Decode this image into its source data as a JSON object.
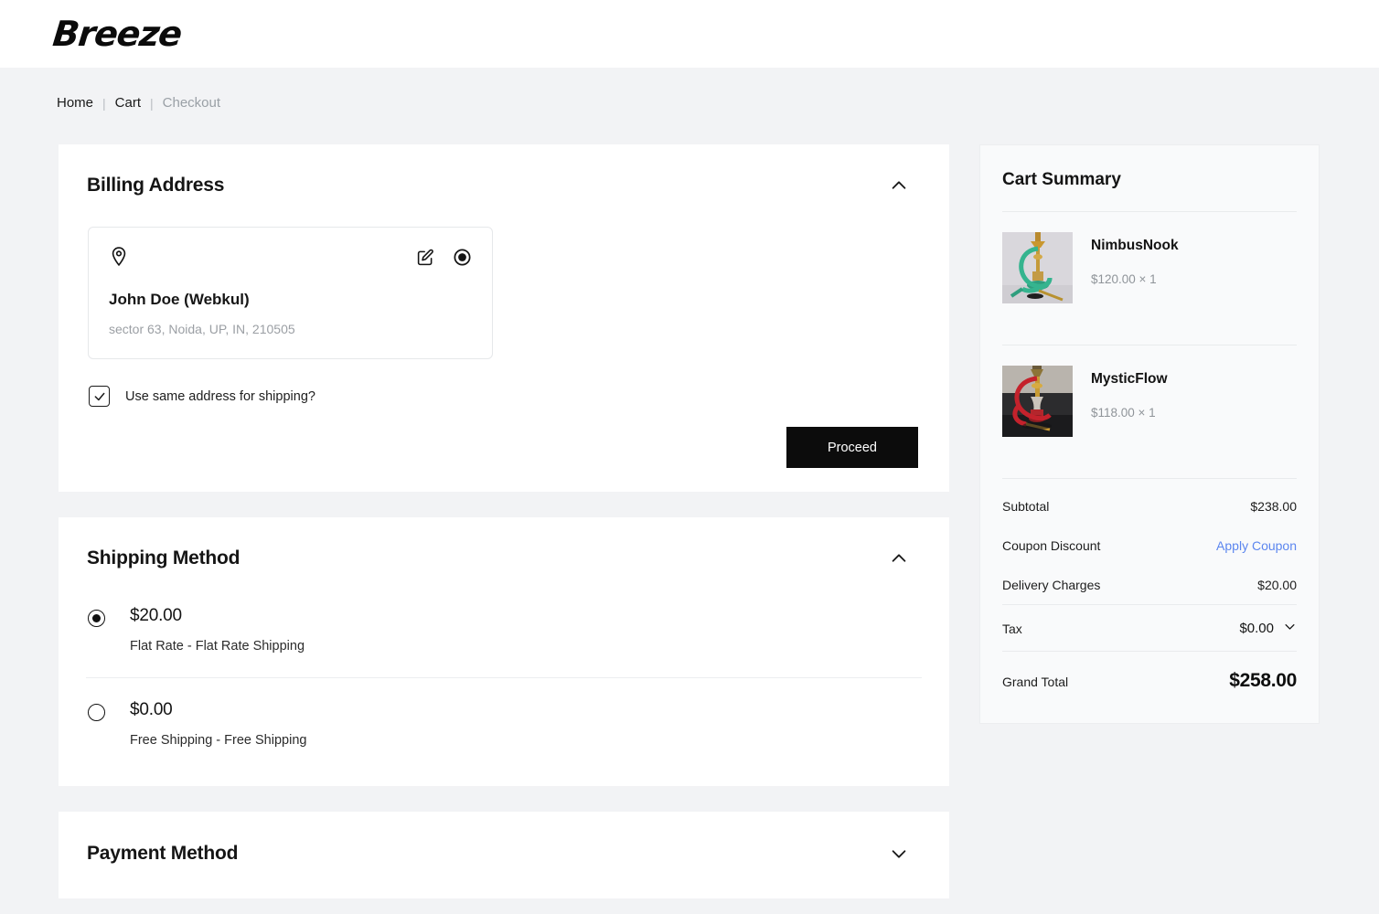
{
  "header": {
    "logo_text": "Breeze"
  },
  "breadcrumb": {
    "items": [
      {
        "label": "Home",
        "current": false
      },
      {
        "label": "Cart",
        "current": false
      },
      {
        "label": "Checkout",
        "current": true
      }
    ],
    "separator": "|"
  },
  "billing": {
    "title": "Billing Address",
    "collapse_icon": "chevron-up-icon",
    "address": {
      "pin_icon": "location-pin-icon",
      "edit_icon": "edit-pencil-icon",
      "select_icon": "radio-selected-icon",
      "name": "John Doe (Webkul)",
      "line": "sector 63, Noida, UP, IN, 210505"
    },
    "same_address_label": "Use same address for shipping?",
    "same_address_checked": true,
    "proceed_label": "Proceed"
  },
  "shipping": {
    "title": "Shipping Method",
    "collapse_icon": "chevron-up-icon",
    "options": [
      {
        "price": "$20.00",
        "description": "Flat Rate - Flat Rate Shipping",
        "selected": true
      },
      {
        "price": "$0.00",
        "description": "Free Shipping - Free Shipping",
        "selected": false
      }
    ]
  },
  "payment": {
    "title": "Payment Method",
    "collapse_icon": "chevron-down-icon"
  },
  "cart_summary": {
    "title": "Cart Summary",
    "items": [
      {
        "name": "NimbusNook",
        "price_qty": "$120.00 × 1",
        "image": "green-hose-hookah-photo"
      },
      {
        "name": "MysticFlow",
        "price_qty": "$118.00 × 1",
        "image": "red-hose-hookah-photo"
      }
    ],
    "totals": {
      "subtotal_label": "Subtotal",
      "subtotal_value": "$238.00",
      "coupon_label": "Coupon Discount",
      "coupon_action": "Apply Coupon",
      "delivery_label": "Delivery Charges",
      "delivery_value": "$20.00",
      "tax_label": "Tax",
      "tax_value": "$0.00",
      "tax_toggle_icon": "chevron-down-icon",
      "grand_label": "Grand Total",
      "grand_value": "$258.00"
    }
  },
  "colors": {
    "page_bg": "#f2f3f5",
    "card_bg": "#ffffff",
    "summary_bg": "#f9fafb",
    "accent_link": "#5c86ef",
    "button_bg": "#0c0c0c",
    "text_primary": "#141414",
    "text_muted": "#9b9fa4"
  }
}
